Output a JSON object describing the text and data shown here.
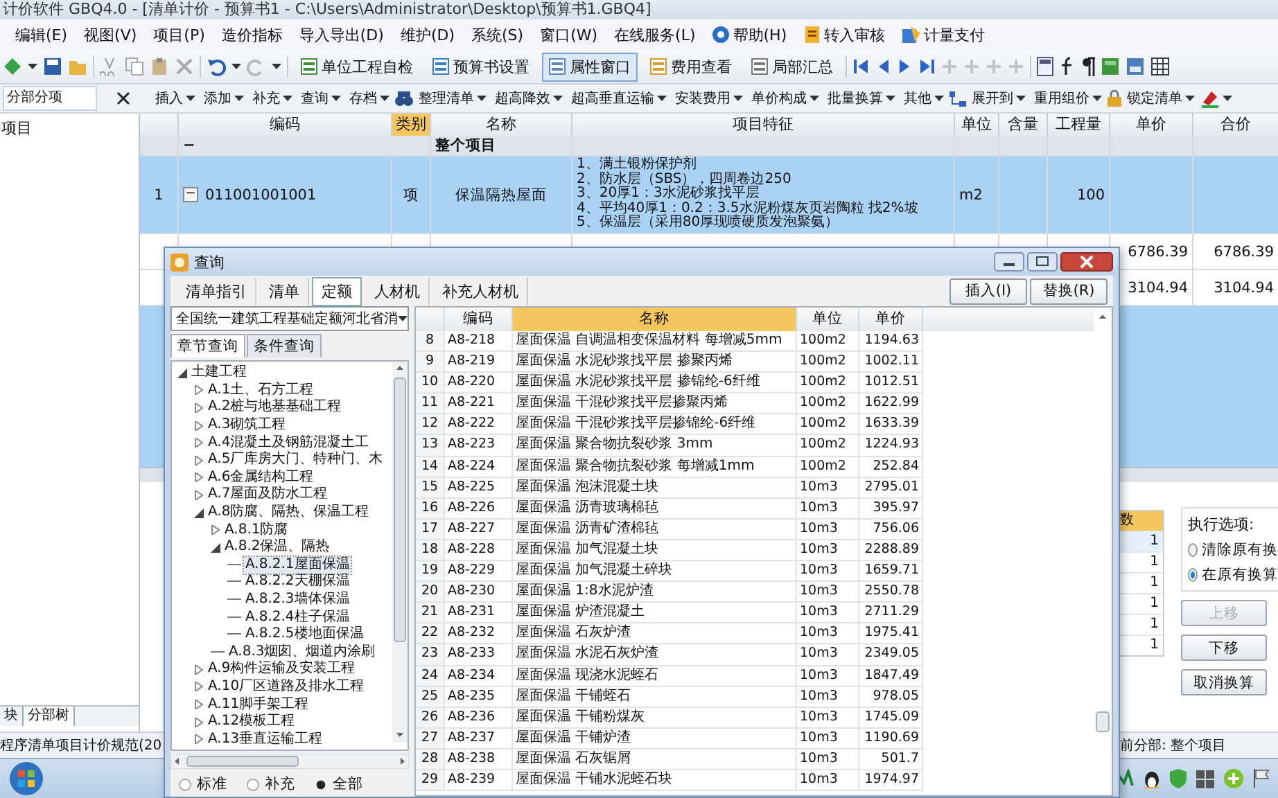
{
  "window": {
    "title": "计价软件 GBQ4.0 - [清单计价 - 预算书1 - C:\\Users\\Administrator\\Desktop\\预算书1.GBQ4]"
  },
  "menu": [
    {
      "label": "编辑(E)",
      "kind": "plain"
    },
    {
      "label": "视图(V)",
      "kind": "plain"
    },
    {
      "label": "项目(P)",
      "kind": "plain"
    },
    {
      "label": "造价指标",
      "kind": "plain"
    },
    {
      "label": "导入导出(D)",
      "kind": "plain"
    },
    {
      "label": "维护(D)",
      "kind": "plain"
    },
    {
      "label": "系统(S)",
      "kind": "plain"
    },
    {
      "label": "窗口(W)",
      "kind": "plain"
    },
    {
      "label": "在线服务(L)",
      "kind": "plain"
    },
    {
      "label": "帮助(H)",
      "kind": "help"
    },
    {
      "label": "转入审核",
      "kind": "doc"
    },
    {
      "label": "计量支付",
      "kind": "pay"
    }
  ],
  "toolbar": [
    {
      "label": "单位工程自检",
      "on": false
    },
    {
      "label": "预算书设置",
      "on": false
    },
    {
      "label": "属性窗口",
      "on": true
    },
    {
      "label": "费用查看",
      "on": false
    },
    {
      "label": "局部汇总",
      "on": false
    }
  ],
  "subtoolbar": {
    "field": "分部分项",
    "items": [
      {
        "label": "插入",
        "kind": "menu"
      },
      {
        "label": "添加",
        "kind": "menu"
      },
      {
        "label": "补充",
        "kind": "menu"
      },
      {
        "label": "查询",
        "kind": "menu"
      },
      {
        "label": "存档",
        "kind": "menu"
      },
      {
        "label": "整理清单",
        "kind": "find"
      },
      {
        "label": "超高降效",
        "kind": "menu"
      },
      {
        "label": "超高垂直运输",
        "kind": "menu"
      },
      {
        "label": "安装费用",
        "kind": "menu"
      },
      {
        "label": "单价构成",
        "kind": "menu"
      },
      {
        "label": "批量换算",
        "kind": "menu"
      },
      {
        "label": "其他",
        "kind": "menu"
      },
      {
        "label": "展开到",
        "kind": "expand"
      },
      {
        "label": "重用组价",
        "kind": "menu"
      },
      {
        "label": "锁定清单",
        "kind": "lock"
      }
    ]
  },
  "side_panel": {
    "title": "项目",
    "tabs": [
      {
        "label": "块",
        "selected": false
      },
      {
        "label": "分部树",
        "selected": true
      }
    ]
  },
  "grid": {
    "columns": [
      {
        "label": "编码",
        "selected": false
      },
      {
        "label": "类别",
        "selected": true
      },
      {
        "label": "名称",
        "selected": false
      },
      {
        "label": "项目特征",
        "selected": false
      },
      {
        "label": "单位",
        "selected": false
      },
      {
        "label": "含量",
        "selected": false
      },
      {
        "label": "工程量",
        "selected": false
      },
      {
        "label": "单价",
        "selected": false
      },
      {
        "label": "合价",
        "selected": false
      }
    ],
    "rows": [
      {
        "kind": "group",
        "toggle": "−",
        "name": "整个项目",
        "selected": false
      },
      {
        "kind": "item",
        "number": "1",
        "toggle": "−",
        "code": "011001001001",
        "type": "项",
        "name": "保温隔热屋面",
        "features": [
          "1、满土银粉保护剂",
          "2、防水层（SBS），四周卷边250",
          "3、20厚1：3水泥砂浆找平层",
          "4、平均40厚1：0.2：3.5水泥粉煤灰页岩陶粒 找2%坡",
          "5、保温层（采用80厚现喷硬质发泡聚氨）"
        ],
        "unit": "m2",
        "quantity": "100",
        "selected": true
      },
      {
        "kind": "sub",
        "price": "6786.39",
        "total": "6786.39",
        "selected": false
      },
      {
        "kind": "sub",
        "price": "3104.94",
        "total": "3104.94",
        "selected": false
      }
    ]
  },
  "bottom": {
    "factor_column": "数",
    "factors": [
      {
        "value": "1",
        "selected": true
      },
      {
        "value": "1",
        "selected": false
      },
      {
        "value": "1",
        "selected": false
      },
      {
        "value": "1",
        "selected": false
      },
      {
        "value": "1",
        "selected": false
      },
      {
        "value": "1",
        "selected": false
      }
    ],
    "options_title": "执行选项:",
    "options": [
      {
        "label": "清除原有换",
        "selected": false
      },
      {
        "label": "在原有换算",
        "selected": true
      }
    ],
    "buttons": [
      {
        "label": "上移",
        "disabled": true
      },
      {
        "label": "下移",
        "disabled": false
      },
      {
        "label": "取消换算",
        "disabled": false
      }
    ]
  },
  "status_bar": {
    "left": "程序清单项目计价规范(20",
    "right": "前分部: 整个项目"
  },
  "dialog": {
    "title": "查询",
    "tabs": [
      {
        "label": "清单指引",
        "selected": false
      },
      {
        "label": "清单",
        "selected": false
      },
      {
        "label": "定额",
        "selected": true
      },
      {
        "label": "人材机",
        "selected": false
      },
      {
        "label": "补充人材机",
        "selected": false
      }
    ],
    "buttons": [
      "插入(I)",
      "替换(R)"
    ],
    "library": "全国统一建筑工程基础定额河北省消",
    "subtabs": [
      {
        "label": "章节查询",
        "selected": true
      },
      {
        "label": "条件查询",
        "selected": false
      }
    ],
    "tree": [
      {
        "label": "土建工程",
        "kind": "folder",
        "expanded": true,
        "selected": false,
        "children": [
          {
            "label": "A.1土、石方工程",
            "kind": "folder",
            "expanded": false,
            "selected": false
          },
          {
            "label": "A.2桩与地基基础工程",
            "kind": "folder",
            "expanded": false,
            "selected": false
          },
          {
            "label": "A.3砌筑工程",
            "kind": "folder",
            "expanded": false,
            "selected": false
          },
          {
            "label": "A.4混凝土及钢筋混凝土工",
            "kind": "folder",
            "expanded": false,
            "selected": false
          },
          {
            "label": "A.5厂库房大门、特种门、木",
            "kind": "folder",
            "expanded": false,
            "selected": false
          },
          {
            "label": "A.6金属结构工程",
            "kind": "folder",
            "expanded": false,
            "selected": false
          },
          {
            "label": "A.7屋面及防水工程",
            "kind": "folder",
            "expanded": false,
            "selected": false
          },
          {
            "label": "A.8防腐、隔热、保温工程",
            "kind": "folder",
            "expanded": true,
            "selected": false,
            "children": [
              {
                "label": "A.8.1防腐",
                "kind": "folder",
                "expanded": false,
                "selected": false
              },
              {
                "label": "A.8.2保温、隔热",
                "kind": "folder",
                "expanded": true,
                "selected": false,
                "children": [
                  {
                    "label": "A.8.2.1屋面保温",
                    "kind": "leaf",
                    "selected": true
                  },
                  {
                    "label": "A.8.2.2天棚保温",
                    "kind": "leaf",
                    "selected": false
                  },
                  {
                    "label": "A.8.2.3墙体保温",
                    "kind": "leaf",
                    "selected": false
                  },
                  {
                    "label": "A.8.2.4柱子保温",
                    "kind": "leaf",
                    "selected": false
                  },
                  {
                    "label": "A.8.2.5楼地面保温",
                    "kind": "leaf",
                    "selected": false
                  }
                ]
              },
              {
                "label": "A.8.3烟囱、烟道内涂刷",
                "kind": "leaf",
                "selected": false
              }
            ]
          },
          {
            "label": "A.9构件运输及安装工程",
            "kind": "folder",
            "expanded": false,
            "selected": false
          },
          {
            "label": "A.10厂区道路及排水工程",
            "kind": "folder",
            "expanded": false,
            "selected": false
          },
          {
            "label": "A.11脚手架工程",
            "kind": "folder",
            "expanded": false,
            "selected": false
          },
          {
            "label": "A.12模板工程",
            "kind": "folder",
            "expanded": false,
            "selected": false
          },
          {
            "label": "A.13垂直运输工程",
            "kind": "folder",
            "expanded": false,
            "selected": false
          }
        ]
      }
    ],
    "filters": [
      {
        "label": "标准",
        "selected": false
      },
      {
        "label": "补充",
        "selected": false
      },
      {
        "label": "全部",
        "selected": true
      }
    ],
    "columns": [
      "编码",
      "名称",
      "单位",
      "单价"
    ],
    "rows": [
      {
        "number": "8",
        "code": "A8-218",
        "name": "屋面保温 自调温相变保温材料 每增减5mm",
        "unit": "100m2",
        "price": "1194.63"
      },
      {
        "number": "9",
        "code": "A8-219",
        "name": "屋面保温 水泥砂浆找平层 掺聚丙烯",
        "unit": "100m2",
        "price": "1002.11"
      },
      {
        "number": "10",
        "code": "A8-220",
        "name": "屋面保温 水泥砂浆找平层 掺锦纶-6纤维",
        "unit": "100m2",
        "price": "1012.51"
      },
      {
        "number": "11",
        "code": "A8-221",
        "name": "屋面保温 干混砂浆找平层掺聚丙烯",
        "unit": "100m2",
        "price": "1622.99"
      },
      {
        "number": "12",
        "code": "A8-222",
        "name": "屋面保温 干混砂浆找平层掺锦纶-6纤维",
        "unit": "100m2",
        "price": "1633.39"
      },
      {
        "number": "13",
        "code": "A8-223",
        "name": "屋面保温 聚合物抗裂砂浆 3mm",
        "unit": "100m2",
        "price": "1224.93"
      },
      {
        "number": "14",
        "code": "A8-224",
        "name": "屋面保温 聚合物抗裂砂浆 每增减1mm",
        "unit": "100m2",
        "price": "252.84"
      },
      {
        "number": "15",
        "code": "A8-225",
        "name": "屋面保温 泡沫混凝土块",
        "unit": "10m3",
        "price": "2795.01"
      },
      {
        "number": "16",
        "code": "A8-226",
        "name": "屋面保温 沥青玻璃棉毡",
        "unit": "10m3",
        "price": "395.97"
      },
      {
        "number": "17",
        "code": "A8-227",
        "name": "屋面保温 沥青矿渣棉毡",
        "unit": "10m3",
        "price": "756.06"
      },
      {
        "number": "18",
        "code": "A8-228",
        "name": "屋面保温 加气混凝土块",
        "unit": "10m3",
        "price": "2288.89"
      },
      {
        "number": "19",
        "code": "A8-229",
        "name": "屋面保温 加气混凝土碎块",
        "unit": "10m3",
        "price": "1659.71"
      },
      {
        "number": "20",
        "code": "A8-230",
        "name": "屋面保温 1:8水泥炉渣",
        "unit": "10m3",
        "price": "2550.78"
      },
      {
        "number": "21",
        "code": "A8-231",
        "name": "屋面保温 炉渣混凝土",
        "unit": "10m3",
        "price": "2711.29"
      },
      {
        "number": "22",
        "code": "A8-232",
        "name": "屋面保温 石灰炉渣",
        "unit": "10m3",
        "price": "1975.41"
      },
      {
        "number": "23",
        "code": "A8-233",
        "name": "屋面保温 水泥石灰炉渣",
        "unit": "10m3",
        "price": "2349.05"
      },
      {
        "number": "24",
        "code": "A8-234",
        "name": "屋面保温 现浇水泥蛭石",
        "unit": "10m3",
        "price": "1847.49"
      },
      {
        "number": "25",
        "code": "A8-235",
        "name": "屋面保温 干铺蛭石",
        "unit": "10m3",
        "price": "978.05"
      },
      {
        "number": "26",
        "code": "A8-236",
        "name": "屋面保温 干铺粉煤灰",
        "unit": "10m3",
        "price": "1745.09"
      },
      {
        "number": "27",
        "code": "A8-237",
        "name": "屋面保温 干铺炉渣",
        "unit": "10m3",
        "price": "1190.69"
      },
      {
        "number": "28",
        "code": "A8-238",
        "name": "屋面保温 石灰锯屑",
        "unit": "10m3",
        "price": "501.7"
      },
      {
        "number": "29",
        "code": "A8-239",
        "name": "屋面保温 干铺水泥蛭石块",
        "unit": "10m3",
        "price": "1974.97"
      }
    ]
  }
}
